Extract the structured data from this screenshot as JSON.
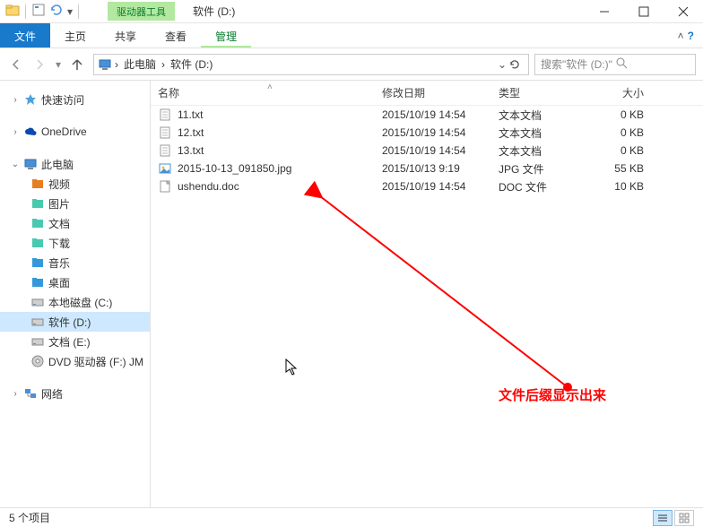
{
  "titlebar": {
    "context_tab": "驱动器工具",
    "title": "软件 (D:)"
  },
  "ribbon": {
    "file": "文件",
    "home": "主页",
    "share": "共享",
    "view": "查看",
    "manage": "管理"
  },
  "breadcrumb": {
    "seg1": "此电脑",
    "seg2": "软件 (D:)"
  },
  "search": {
    "placeholder": "搜索\"软件 (D:)\""
  },
  "sidebar": {
    "quick": "快速访问",
    "onedrive": "OneDrive",
    "pc": "此电脑",
    "children": [
      {
        "label": "视频"
      },
      {
        "label": "图片"
      },
      {
        "label": "文档"
      },
      {
        "label": "下载"
      },
      {
        "label": "音乐"
      },
      {
        "label": "桌面"
      },
      {
        "label": "本地磁盘 (C:)"
      },
      {
        "label": "软件 (D:)"
      },
      {
        "label": "文档 (E:)"
      },
      {
        "label": "DVD 驱动器 (F:) JM"
      }
    ],
    "network": "网络"
  },
  "columns": {
    "name": "名称",
    "date": "修改日期",
    "type": "类型",
    "size": "大小"
  },
  "files": [
    {
      "name": "11.txt",
      "date": "2015/10/19 14:54",
      "type": "文本文档",
      "size": "0 KB",
      "kind": "txt"
    },
    {
      "name": "12.txt",
      "date": "2015/10/19 14:54",
      "type": "文本文档",
      "size": "0 KB",
      "kind": "txt"
    },
    {
      "name": "13.txt",
      "date": "2015/10/19 14:54",
      "type": "文本文档",
      "size": "0 KB",
      "kind": "txt"
    },
    {
      "name": "2015-10-13_091850.jpg",
      "date": "2015/10/13 9:19",
      "type": "JPG 文件",
      "size": "55 KB",
      "kind": "jpg"
    },
    {
      "name": "ushendu.doc",
      "date": "2015/10/19 14:54",
      "type": "DOC 文件",
      "size": "10 KB",
      "kind": "doc"
    }
  ],
  "annotation": "文件后缀显示出来",
  "status": {
    "count": "5 个项目"
  }
}
